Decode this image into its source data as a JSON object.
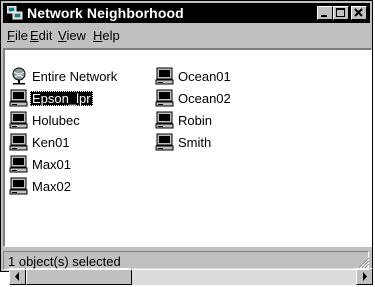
{
  "window": {
    "title": "Network Neighborhood"
  },
  "menu": [
    {
      "label": "File",
      "accel": "F",
      "rest": "ile"
    },
    {
      "label": "Edit",
      "accel": "E",
      "rest": "dit"
    },
    {
      "label": "View",
      "accel": "V",
      "rest": "iew"
    },
    {
      "label": "Help",
      "accel": "H",
      "rest": "elp"
    }
  ],
  "items": [
    {
      "label": "Entire Network",
      "icon": "entire-network-icon",
      "selected": false
    },
    {
      "label": "Epson_lpr",
      "icon": "computer-icon",
      "selected": true
    },
    {
      "label": "Holubec",
      "icon": "computer-icon",
      "selected": false
    },
    {
      "label": "Ken01",
      "icon": "computer-icon",
      "selected": false
    },
    {
      "label": "Max01",
      "icon": "computer-icon",
      "selected": false
    },
    {
      "label": "Max02",
      "icon": "computer-icon",
      "selected": false
    },
    {
      "label": "Ocean01",
      "icon": "computer-icon",
      "selected": false
    },
    {
      "label": "Ocean02",
      "icon": "computer-icon",
      "selected": false
    },
    {
      "label": "Robin",
      "icon": "computer-icon",
      "selected": false
    },
    {
      "label": "Smith",
      "icon": "computer-icon",
      "selected": false
    }
  ],
  "status": {
    "text": "1 object(s) selected"
  }
}
